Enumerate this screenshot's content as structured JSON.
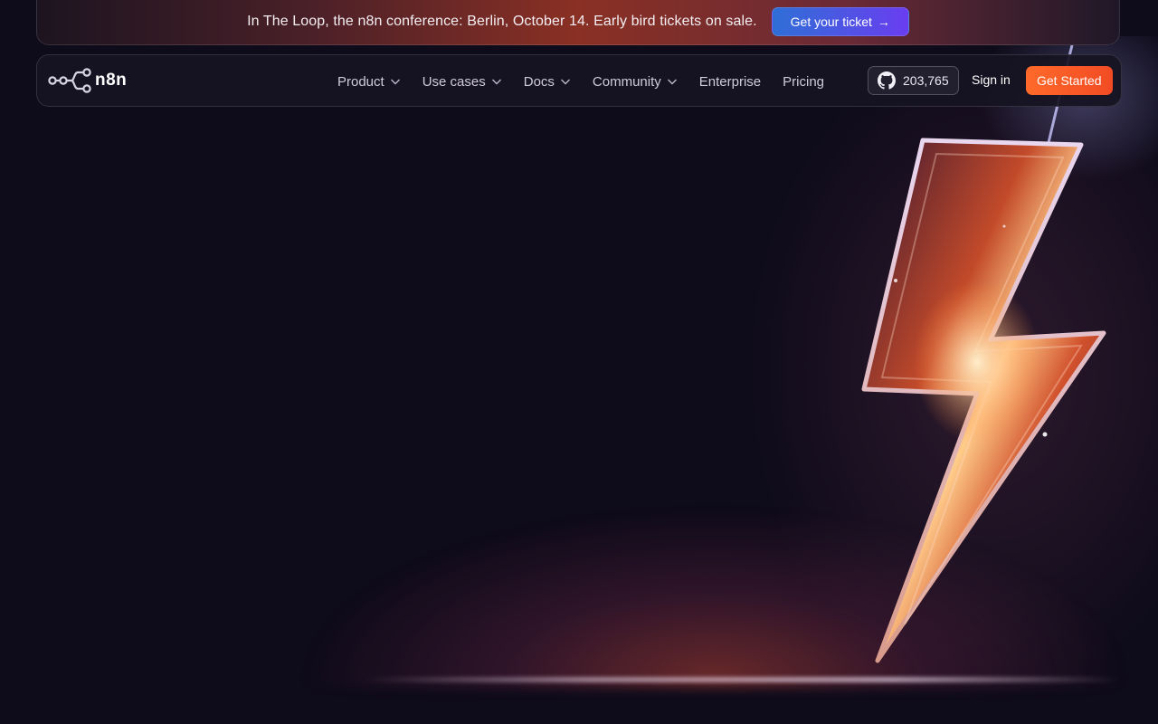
{
  "banner": {
    "text": "In The Loop, the n8n conference: Berlin, October 14. Early bird tickets on sale.",
    "button_label": "Get your ticket",
    "button_arrow": "→"
  },
  "navbar": {
    "logo_text": "n8n",
    "items": [
      {
        "label": "Product",
        "has_dropdown": true
      },
      {
        "label": "Use cases",
        "has_dropdown": true
      },
      {
        "label": "Docs",
        "has_dropdown": true
      },
      {
        "label": "Community",
        "has_dropdown": true
      },
      {
        "label": "Enterprise",
        "has_dropdown": false
      },
      {
        "label": "Pricing",
        "has_dropdown": false
      }
    ],
    "github_stars": "203,765",
    "signin_label": "Sign in",
    "cta_label": "Get Started"
  },
  "icons": {
    "logo": "n8n-logo-icon",
    "github": "github-icon",
    "chevron": "chevron-down-icon",
    "hero": "lightning-bolt-icon"
  },
  "colors": {
    "background": "#0e0b1a",
    "cta": "#ff6a2a",
    "ticket_button": "#4f55e6"
  }
}
